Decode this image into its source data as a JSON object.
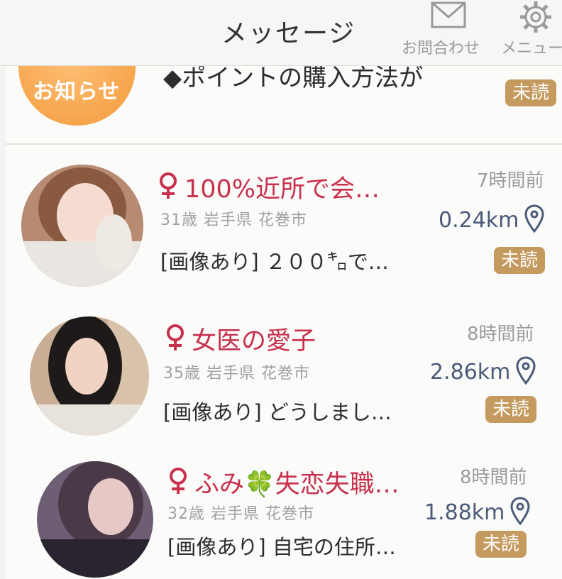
{
  "header": {
    "title": "メッセージ",
    "contact_label": "お問合わせ",
    "menu_label": "メニュー"
  },
  "notice": {
    "label": "お知らせ",
    "text": "◆ポイントの購入方法が",
    "badge": "未読"
  },
  "messages": [
    {
      "name": "100%近所で会…",
      "time": "7時間前",
      "meta": "31歳 岩手県 花巻市",
      "distance": "0.24km",
      "message": "[画像あり] ２００㌔で…",
      "badge": "未読"
    },
    {
      "name": "女医の愛子",
      "time": "8時間前",
      "meta": "35歳 岩手県 花巻市",
      "distance": "2.86km",
      "message": "[画像あり] どうしまし…",
      "badge": "未読"
    },
    {
      "name": "ふみ🍀失恋失職…",
      "time": "8時間前",
      "meta": "32歳 岩手県 花巻市",
      "distance": "1.88km",
      "message": "[画像あり] 自宅の住所…",
      "badge": "未読"
    }
  ],
  "colors": {
    "name": "#c8304c",
    "badge": "#c49a5e",
    "distance": "#4a5a78",
    "notice": "#f39a3a"
  }
}
